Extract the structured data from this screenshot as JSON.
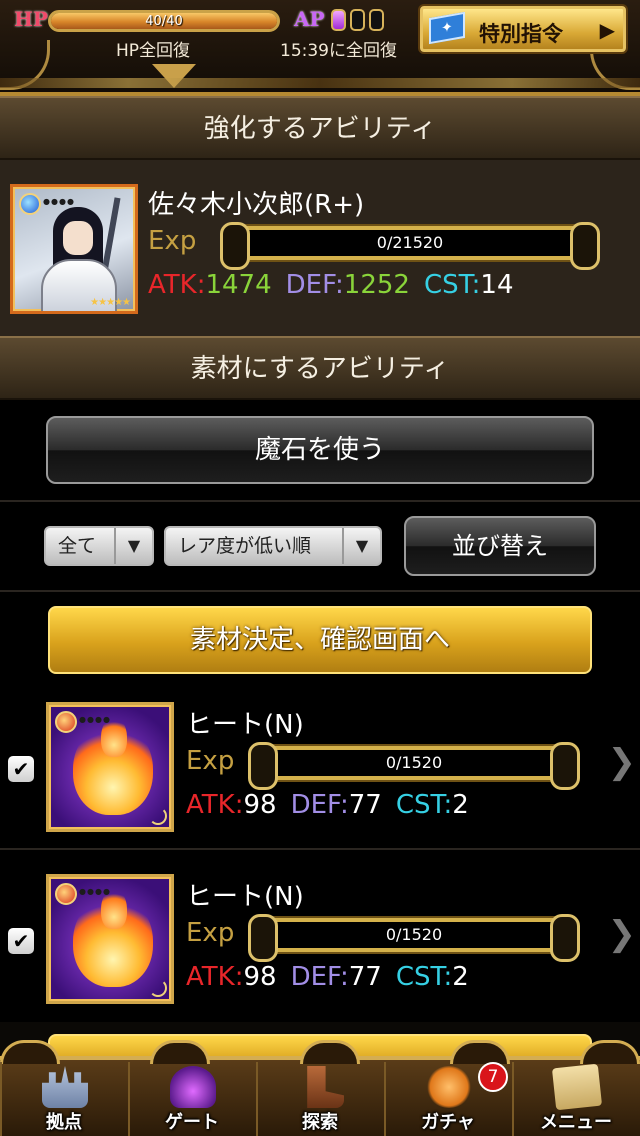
{
  "status": {
    "hp_label": "HP",
    "hp_value": "40/40",
    "hp_fraction": 1.0,
    "hp_recovery": "HP全回復",
    "ap_label": "AP",
    "ap_pips_filled": 1,
    "ap_pips_total": 3,
    "ap_recovery": "15:39に全回復",
    "special_order_label": "特別指令",
    "special_order_arrow": "▶"
  },
  "target_section": {
    "header": "強化するアビリティ",
    "card": {
      "name": "佐々木小次郎(R+)",
      "exp_label": "Exp",
      "exp_value": "0/21520",
      "atk_label": "ATK:",
      "atk_value": "1474",
      "def_label": "DEF:",
      "def_value": "1252",
      "cst_label": "CST:",
      "cst_value": "14",
      "element": "water",
      "portrait_icon": "samurai-portrait"
    }
  },
  "material_section": {
    "header": "素材にするアビリティ",
    "magic_stone_button": "魔石を使う",
    "filter": {
      "selected": "全て",
      "arrow": "▼"
    },
    "sort_order": {
      "selected": "レア度が低い順",
      "arrow": "▼"
    },
    "sort_button": "並び替え",
    "confirm_button": "素材決定、確認画面へ",
    "items": [
      {
        "checked": true,
        "check_mark": "✔",
        "name": "ヒート(N)",
        "exp_label": "Exp",
        "exp_value": "0/1520",
        "atk_label": "ATK:",
        "atk_value": "98",
        "def_label": "DEF:",
        "def_value": "77",
        "cst_label": "CST:",
        "cst_value": "2",
        "element": "fire",
        "chevron": "❯"
      },
      {
        "checked": true,
        "check_mark": "✔",
        "name": "ヒート(N)",
        "exp_label": "Exp",
        "exp_value": "0/1520",
        "atk_label": "ATK:",
        "atk_value": "98",
        "def_label": "DEF:",
        "def_value": "77",
        "cst_label": "CST:",
        "cst_value": "2",
        "element": "fire",
        "chevron": "❯"
      }
    ]
  },
  "bottom_nav": {
    "items": [
      {
        "label": "拠点",
        "icon": "castle-icon"
      },
      {
        "label": "ゲート",
        "icon": "gate-icon"
      },
      {
        "label": "探索",
        "icon": "boots-icon"
      },
      {
        "label": "ガチャ",
        "icon": "gacha-icon",
        "badge": "7"
      },
      {
        "label": "メニュー",
        "icon": "scroll-menu-icon"
      }
    ]
  },
  "colors": {
    "atk": "#e8262a",
    "def": "#a28ee6",
    "cst": "#36d0e4",
    "exp_label": "#c5a042",
    "gold_button": "#d9a21c",
    "target_stat_value": "#8ad43a"
  }
}
